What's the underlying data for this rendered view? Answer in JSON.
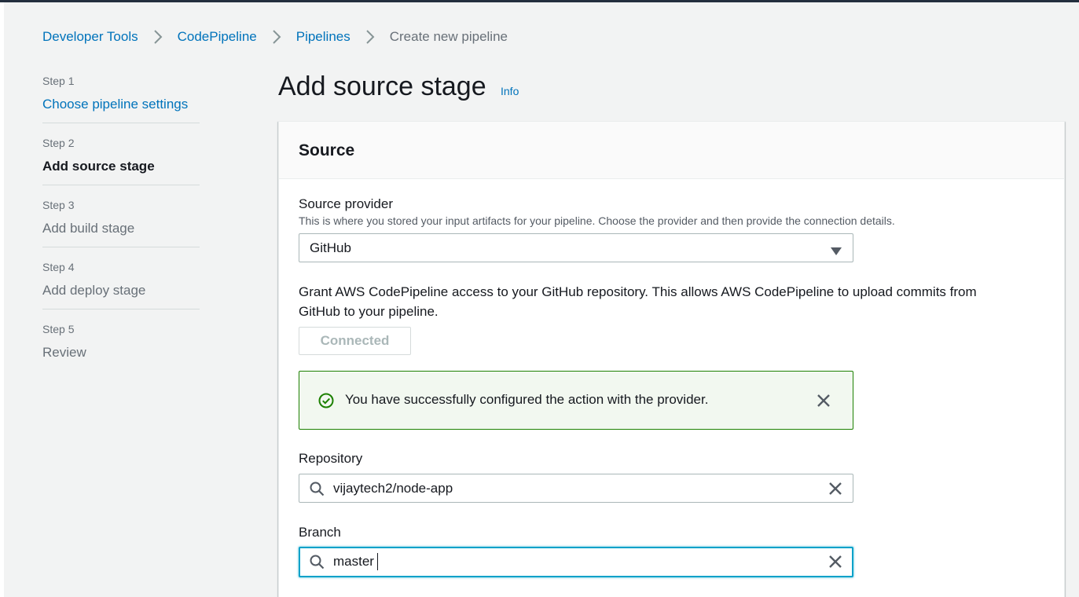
{
  "breadcrumb": {
    "items": [
      {
        "label": "Developer Tools"
      },
      {
        "label": "CodePipeline"
      },
      {
        "label": "Pipelines"
      },
      {
        "label": "Create new pipeline"
      }
    ],
    "separator_icon": "chevron-right-icon"
  },
  "steps": [
    {
      "number": "Step 1",
      "title": "Choose pipeline settings",
      "state": "link"
    },
    {
      "number": "Step 2",
      "title": "Add source stage",
      "state": "active"
    },
    {
      "number": "Step 3",
      "title": "Add build stage",
      "state": "disabled"
    },
    {
      "number": "Step 4",
      "title": "Add deploy stage",
      "state": "disabled"
    },
    {
      "number": "Step 5",
      "title": "Review",
      "state": "disabled"
    }
  ],
  "page": {
    "title": "Add source stage",
    "info_link": "Info"
  },
  "source": {
    "header": "Source",
    "provider": {
      "label": "Source provider",
      "description": "This is where you stored your input artifacts for your pipeline. Choose the provider and then provide the connection details.",
      "value": "GitHub"
    },
    "grant_text": "Grant AWS CodePipeline access to your GitHub repository. This allows AWS CodePipeline to upload commits from GitHub to your pipeline.",
    "connected_button": "Connected",
    "flash": {
      "message": "You have successfully configured the action with the provider.",
      "icon": "success-check-icon"
    },
    "repository": {
      "label": "Repository",
      "value": "vijaytech2/node-app"
    },
    "branch": {
      "label": "Branch",
      "value": "master"
    }
  },
  "colors": {
    "link": "#0073bb",
    "success": "#1d8102",
    "focus": "#00a1c9",
    "text": "#16191f",
    "muted": "#687078"
  }
}
